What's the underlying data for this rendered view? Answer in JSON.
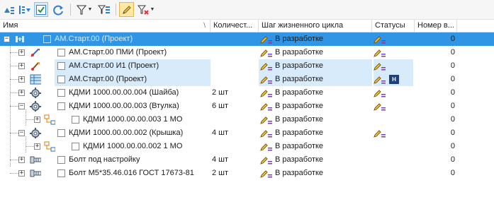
{
  "toolbar": {
    "buttons": [
      {
        "name": "sort-tree-icon"
      },
      {
        "name": "collapse-levels-icon"
      },
      {
        "name": "check-all-icon"
      },
      {
        "name": "refresh-icon"
      },
      {
        "name": "filter-icon"
      },
      {
        "name": "filter-tree-icon"
      },
      {
        "name": "edit-pencil-icon"
      },
      {
        "name": "clear-filter-icon"
      }
    ]
  },
  "columns": {
    "name": "Имя",
    "name_sort": "\\",
    "qty": "Количест...",
    "stage": "Шаг жизненного цикла",
    "status": "Статусы",
    "number": "Номер в..."
  },
  "rows": [
    {
      "name": "АМ.Старт.00 (Проект)",
      "qty": "",
      "stage": "В разработке",
      "status_badge": "",
      "number": "0"
    },
    {
      "name": "АМ.Старт.00 ПМИ (Проект)",
      "qty": "",
      "stage": "В разработке",
      "status_badge": "",
      "number": "0"
    },
    {
      "name": "АМ.Старт.00 И1 (Проект)",
      "qty": "",
      "stage": "В разработке",
      "status_badge": "",
      "number": "0"
    },
    {
      "name": "АМ.Старт.00 (Проект)",
      "qty": "",
      "stage": "В разработке",
      "status_badge": "Н",
      "number": "0"
    },
    {
      "name": "КДМИ 1000.00.00.004 (Шайба)",
      "qty": "2 шт",
      "stage": "В разработке",
      "status_badge": "",
      "number": "0"
    },
    {
      "name": "КДМИ 1000.00.00.003 (Втулка)",
      "qty": "6 шт",
      "stage": "В разработке",
      "status_badge": "",
      "number": "0"
    },
    {
      "name": "КДМИ 1000.00.00.003 1 МО",
      "qty": "",
      "stage": "В разработке",
      "status_badge": "",
      "number": "0"
    },
    {
      "name": "КДМИ 1000.00.00.002 (Крышка)",
      "qty": "4 шт",
      "stage": "В разработке",
      "status_badge": "",
      "number": "0"
    },
    {
      "name": "КДМИ 1000.00.00.002 1 МО",
      "qty": "",
      "stage": "В разработке",
      "status_badge": "",
      "number": "0"
    },
    {
      "name": "Болт под настройку",
      "qty": "4 шт",
      "stage": "В разработке",
      "status_badge": "",
      "number": "0"
    },
    {
      "name": "Болт М5*35.46.016 ГОСТ 17673-81",
      "qty": "2 шт",
      "stage": "В разработке",
      "status_badge": "",
      "number": "0"
    }
  ]
}
